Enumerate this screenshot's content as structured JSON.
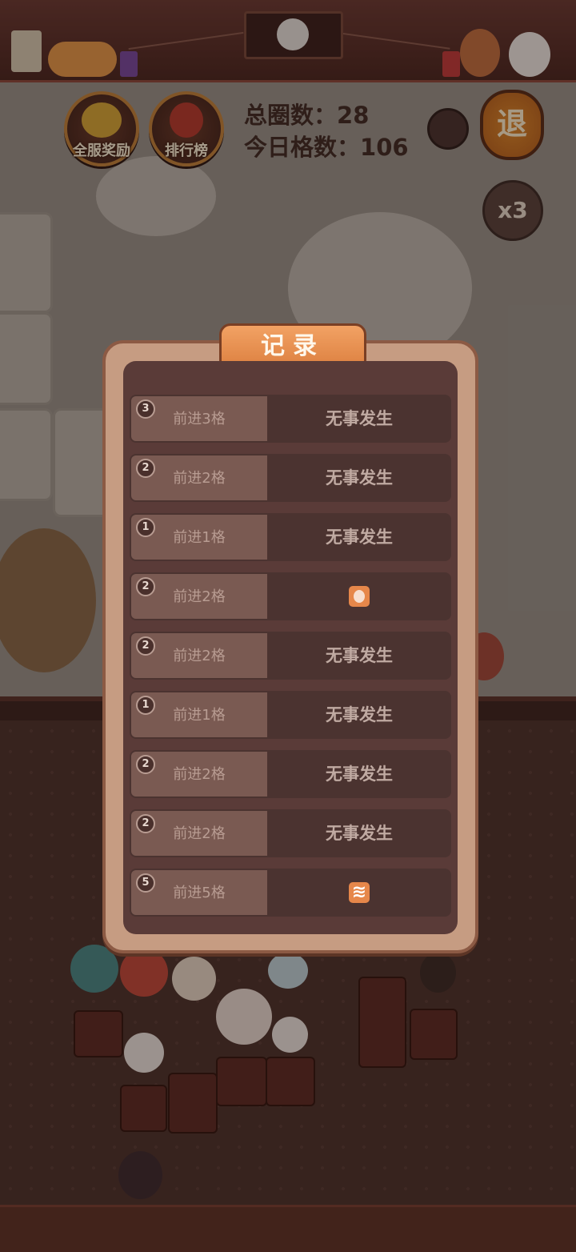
{
  "hud": {
    "server_rewards_label": "全服奖励",
    "leaderboard_label": "排行榜",
    "total_laps_label": "总圈数：",
    "total_laps_value": "28",
    "today_steps_label": "今日格数：",
    "today_steps_value": "106",
    "exit_label": "退",
    "multiplier_label": "x3"
  },
  "record_dialog": {
    "title": "记录",
    "rows": [
      {
        "badge": "3",
        "move": "前进3格",
        "result": "无事发生",
        "icon": ""
      },
      {
        "badge": "2",
        "move": "前进2格",
        "result": "无事发生",
        "icon": ""
      },
      {
        "badge": "1",
        "move": "前进1格",
        "result": "无事发生",
        "icon": ""
      },
      {
        "badge": "2",
        "move": "前进2格",
        "result": "",
        "icon": "pig-token-icon"
      },
      {
        "badge": "2",
        "move": "前进2格",
        "result": "无事发生",
        "icon": ""
      },
      {
        "badge": "1",
        "move": "前进1格",
        "result": "无事发生",
        "icon": ""
      },
      {
        "badge": "2",
        "move": "前进2格",
        "result": "无事发生",
        "icon": ""
      },
      {
        "badge": "2",
        "move": "前进2格",
        "result": "无事发生",
        "icon": ""
      },
      {
        "badge": "5",
        "move": "前进5格",
        "result": "",
        "icon": "wave-token-icon"
      }
    ]
  },
  "colors": {
    "dialog_title_bg": "#e48a48",
    "dialog_frame": "#c69c82",
    "dialog_inner": "#5a3b38",
    "exit_button": "#d87a28"
  }
}
